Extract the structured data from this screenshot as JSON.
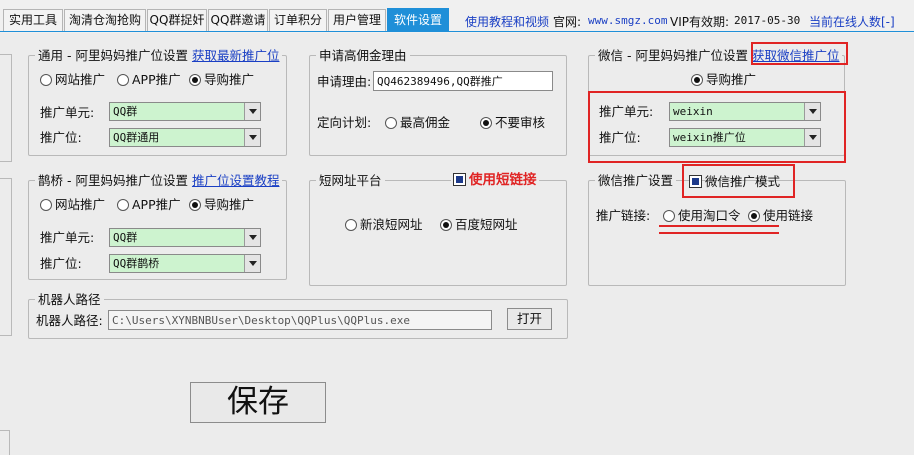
{
  "tabs": [
    {
      "label": "实用工具",
      "active": false
    },
    {
      "label": "淘清仓淘抢购",
      "active": false
    },
    {
      "label": "QQ群捉奸",
      "active": false
    },
    {
      "label": "QQ群邀请",
      "active": false
    },
    {
      "label": "订单积分",
      "active": false
    },
    {
      "label": "用户管理",
      "active": false
    },
    {
      "label": "软件设置",
      "active": true
    }
  ],
  "header": {
    "tutorial_link": "使用教程和视频",
    "site_label": "官网:",
    "site_url": "www.smgz.com",
    "vip_label": "VIP有效期:",
    "vip_date": "2017-05-30",
    "online_link": "当前在线人数[-]"
  },
  "general": {
    "title": "通用 - 阿里妈妈推广位设置",
    "link": "获取最新推广位",
    "radios": [
      "网站推广",
      "APP推广",
      "导购推广"
    ],
    "selected": 2,
    "unit_label": "推广单元:",
    "unit_value": "QQ群",
    "pos_label": "推广位:",
    "pos_value": "QQ群通用"
  },
  "reason": {
    "title": "申请高佣金理由",
    "label": "申请理由:",
    "value": "QQ462389496,QQ群推广",
    "plan_label": "定向计划:",
    "plan_options": [
      "最高佣金",
      "不要审核"
    ],
    "plan_selected": 1
  },
  "wechat": {
    "title": "微信 - 阿里妈妈推广位设置",
    "link": "获取微信推广位",
    "radio": "导购推广",
    "unit_label": "推广单元:",
    "unit_value": "weixin",
    "pos_label": "推广位:",
    "pos_value": "weixin推广位"
  },
  "queqiao": {
    "title": "鹊桥 - 阿里妈妈推广位设置",
    "link": "推广位设置教程",
    "radios": [
      "网站推广",
      "APP推广",
      "导购推广"
    ],
    "selected": 2,
    "unit_label": "推广单元:",
    "unit_value": "QQ群",
    "pos_label": "推广位:",
    "pos_value": "QQ群鹊桥"
  },
  "shorturl": {
    "title": "短网址平台",
    "use_short": "使用短链接",
    "options": [
      "新浪短网址",
      "百度短网址"
    ],
    "selected": 1
  },
  "wechat_promo": {
    "title": "微信推广设置",
    "mode_label": "微信推广模式",
    "link_label": "推广链接:",
    "options": [
      "使用淘口令",
      "使用链接"
    ],
    "selected": 1
  },
  "robot": {
    "title": "机器人路径",
    "label": "机器人路径:",
    "path": "C:\\Users\\XYNBNBUser\\Desktop\\QQPlus\\QQPlus.exe",
    "open_button": "打开"
  },
  "save_button": "保存",
  "colors": {
    "accent": "#1f8fd8",
    "link": "#1a3fc4",
    "highlight": "#e02424",
    "combo_bg": "#cdf3cf"
  }
}
